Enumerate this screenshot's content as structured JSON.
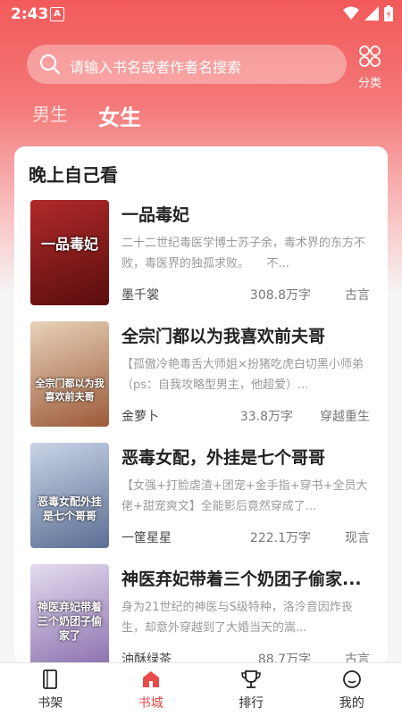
{
  "status": {
    "time": "2:43",
    "a_label": "A"
  },
  "search": {
    "placeholder": "请输入书名或者作者名搜索"
  },
  "category": {
    "label": "分类"
  },
  "gender_tabs": [
    {
      "label": "男生",
      "active": false
    },
    {
      "label": "女生",
      "active": true
    }
  ],
  "section": {
    "title": "晚上自己看",
    "books": [
      {
        "title": "一品毒妃",
        "desc": "二十二世纪毒医学博士苏子余，毒术界的东方不败，毒医界的独孤求败。　　不...",
        "author": "墨千裳",
        "words": "308.8万字",
        "genre": "古言",
        "cover_text": "一品毒妃",
        "cover_color": "#8b1a1a"
      },
      {
        "title": "全宗门都以为我喜欢前夫哥",
        "desc": "【孤傲冷艳毒舌大师姐×扮猪吃虎白切黑小师弟（ps：自我攻略型男主，他超爱）...",
        "author": "金萝卜",
        "words": "33.8万字",
        "genre": "穿越重生",
        "cover_text": "全宗门都以为我喜欢前夫哥",
        "cover_color": "#c9a27a"
      },
      {
        "title": "恶毒女配，外挂是七个哥哥",
        "desc": "【女强+打脸虐渣+团宠+金手指+穿书+全员大佬+甜宠爽文】全能影后竟然穿成了...",
        "author": "一筐星星",
        "words": "222.1万字",
        "genre": "现言",
        "cover_text": "恶毒女配外挂是七个哥哥",
        "cover_color": "#6b7fa6"
      },
      {
        "title": "神医弃妃带着三个奶团子偷家...",
        "desc": "身为21世纪的神医与S级特种，洛泠音因炸丧生，却意外穿越到了大婚当天的嵩...",
        "author": "油酥绿茶",
        "words": "88.7万字",
        "genre": "古言",
        "cover_text": "神医弃妃带着三个奶团子偷家了",
        "cover_color": "#9a84b8"
      }
    ]
  },
  "tabbar": [
    {
      "label": "书架",
      "icon": "bookshelf-icon",
      "active": false
    },
    {
      "label": "书城",
      "icon": "store-icon",
      "active": true
    },
    {
      "label": "排行",
      "icon": "trophy-icon",
      "active": false
    },
    {
      "label": "我的",
      "icon": "profile-icon",
      "active": false
    }
  ],
  "accent": "#e94a4a"
}
